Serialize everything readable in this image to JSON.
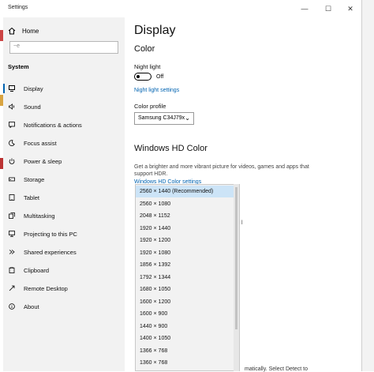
{
  "window": {
    "title": "Settings",
    "controls": [
      "—",
      "☐",
      "✕"
    ]
  },
  "sidebar": {
    "home_label": "Home",
    "search_placeholder": "",
    "search_value": "~e",
    "section_label": "System",
    "items": [
      {
        "label": "Display",
        "icon": "display-icon",
        "selected": true
      },
      {
        "label": "Sound",
        "icon": "speaker-icon"
      },
      {
        "label": "Notifications & actions",
        "icon": "notification-icon"
      },
      {
        "label": "Focus assist",
        "icon": "moon-icon"
      },
      {
        "label": "Power & sleep",
        "icon": "power-icon"
      },
      {
        "label": "Storage",
        "icon": "storage-icon"
      },
      {
        "label": "Tablet",
        "icon": "tablet-icon"
      },
      {
        "label": "Multitasking",
        "icon": "multitasking-icon"
      },
      {
        "label": "Projecting to this PC",
        "icon": "projecting-icon"
      },
      {
        "label": "Shared experiences",
        "icon": "shared-icon"
      },
      {
        "label": "Clipboard",
        "icon": "clipboard-icon"
      },
      {
        "label": "Remote Desktop",
        "icon": "remote-icon"
      },
      {
        "label": "About",
        "icon": "info-icon"
      }
    ]
  },
  "content": {
    "page_title": "Display",
    "color_heading": "Color",
    "night_light_label": "Night light",
    "night_light_state": "Off",
    "night_light_settings_link": "Night light settings",
    "color_profile_label": "Color profile",
    "color_profile_value": "Samsung C34J79x",
    "hdr_heading": "Windows HD Color",
    "hdr_description": "Get a brighter and more vibrant picture for videos, games and apps that support HDR.",
    "hdr_link": "Windows HD Color settings",
    "partial_text": "l",
    "trailing_text": "matically. Select Detect to"
  },
  "resolution_dropdown": {
    "selected": "2560 × 1440 (Recommended)",
    "options": [
      "2560 × 1440 (Recommended)",
      "2560 × 1080",
      "2048 × 1152",
      "1920 × 1440",
      "1920 × 1200",
      "1920 × 1080",
      "1856 × 1392",
      "1792 × 1344",
      "1680 × 1050",
      "1600 × 1200",
      "1600 × 900",
      "1440 × 900",
      "1400 × 1050",
      "1366 × 768",
      "1360 × 768"
    ]
  },
  "colors": {
    "accent": "#0063b1",
    "sidebar_bg": "#f2f2f2",
    "dropdown_bg": "#f2f2f2",
    "selection": "#cce4f7"
  }
}
